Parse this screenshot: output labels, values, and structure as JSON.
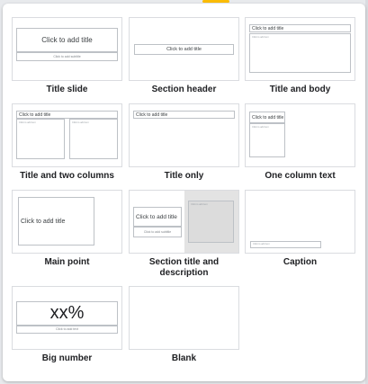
{
  "layouts": [
    {
      "name": "Title and body",
      "title_ph": "Click to add title",
      "body_ph": "Click to add text"
    },
    {
      "name": "Title and two columns",
      "title_ph": "Click to add title",
      "left_ph": "Click to add text",
      "right_ph": "Click to add text"
    },
    {
      "name": "Title only",
      "title_ph": "Click to add title"
    },
    {
      "name": "One column text",
      "title_ph": "Click to add title",
      "body_ph": "Click to add text"
    },
    {
      "name": "Main point",
      "title_ph": "Click to add title"
    },
    {
      "name": "Section title and description",
      "title_ph": "Click to add title",
      "sub_ph": "Click to add subtitle",
      "right_ph": "Click to add text"
    },
    {
      "name": "Caption",
      "caption_ph": "Click to add text"
    },
    {
      "name": "Big number",
      "number": "xx%",
      "body_ph": "Click to add text"
    },
    {
      "name": "Blank"
    }
  ],
  "title_slide": {
    "name": "Title slide",
    "title_ph": "Click to add title",
    "sub_ph": "Click to add subtitle"
  },
  "section_header": {
    "name": "Section header",
    "title_ph": "Click to add title"
  }
}
